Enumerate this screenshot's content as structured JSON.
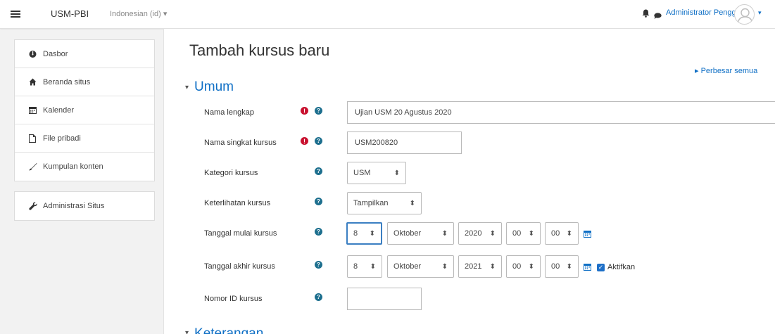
{
  "navbar": {
    "menu_icon": "hamburger-icon",
    "brand": "USM-PBI",
    "language": "Indonesian (id) ▾",
    "bell_icon": "bell-icon",
    "chat_icon": "chat-icon",
    "username": "Administrator Pengguna",
    "avatar_caret": "▾"
  },
  "sidebar": {
    "items": [
      {
        "label": "Dasbor",
        "icon": "dashboard-icon"
      },
      {
        "label": "Beranda situs",
        "icon": "home-icon"
      },
      {
        "label": "Kalender",
        "icon": "calendar-icon"
      },
      {
        "label": "File pribadi",
        "icon": "file-icon"
      },
      {
        "label": "Kumpulan konten",
        "icon": "pencil-icon"
      }
    ],
    "admin_item": {
      "label": "Administrasi Situs",
      "icon": "wrench-icon"
    }
  },
  "main": {
    "title": "Tambah kursus baru",
    "expand_all": "▸ Perbesar semua",
    "section_general": "Umum",
    "section_next": "Keterangan",
    "fields": {
      "fullname": {
        "label": "Nama lengkap",
        "value": "Ujian USM 20 Agustus 2020"
      },
      "shortname": {
        "label": "Nama singkat kursus",
        "value": "USM200820"
      },
      "category": {
        "label": "Kategori kursus",
        "value": "USM"
      },
      "visibility": {
        "label": "Keterlihatan kursus",
        "value": "Tampilkan"
      },
      "startdate": {
        "label": "Tanggal mulai kursus",
        "day": "8",
        "month": "Oktober",
        "year": "2020",
        "hour": "00",
        "minute": "00"
      },
      "enddate": {
        "label": "Tanggal akhir kursus",
        "day": "8",
        "month": "Oktober",
        "year": "2021",
        "hour": "00",
        "minute": "00",
        "enable_label": "Aktifkan"
      },
      "idnumber": {
        "label": "Nomor ID kursus",
        "value": ""
      }
    },
    "required_symbol": "!",
    "help_symbol": "?",
    "select_arrow": "⬍"
  },
  "colors": {
    "link": "#0f6fc5",
    "required": "#c8102e",
    "help": "#1d6f8e",
    "focus": "#3b7fc2"
  }
}
